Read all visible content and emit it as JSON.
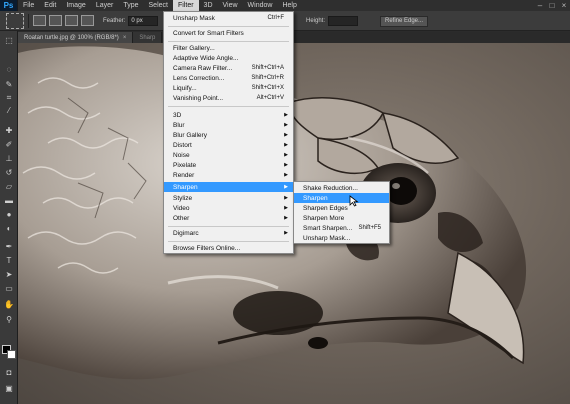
{
  "app": {
    "logo": "Ps",
    "menus": [
      "File",
      "Edit",
      "Image",
      "Layer",
      "Type",
      "Select",
      "Filter",
      "3D",
      "View",
      "Window",
      "Help"
    ],
    "active_menu": "Filter"
  },
  "options_bar": {
    "feather_label": "Feather:",
    "feather_value": "0 px",
    "height_label": "Height:",
    "refine_edge": "Refine Edge..."
  },
  "tabs": [
    {
      "label": "Roatan turtle.jpg @ 100% (RGB/8*)",
      "close": "×"
    },
    {
      "label": "Sharp"
    }
  ],
  "tools": {
    "icons": [
      "marquee-icon",
      "lasso-icon",
      "quick-select-icon",
      "crop-icon",
      "eyedropper-icon",
      "healing-brush-icon",
      "brush-icon",
      "clone-stamp-icon",
      "history-brush-icon",
      "eraser-icon",
      "gradient-icon",
      "blur-icon",
      "dodge-icon",
      "pen-icon",
      "type-icon",
      "path-select-icon",
      "shape-icon",
      "hand-icon",
      "zoom-icon"
    ]
  },
  "filter_menu": {
    "items": [
      {
        "label": "Unsharp Mask",
        "shortcut": "Ctrl+F"
      },
      {
        "label": "Convert for Smart Filters"
      },
      {
        "label": "Filter Gallery..."
      },
      {
        "label": "Adaptive Wide Angle...",
        "shortcut": ""
      },
      {
        "label": "Camera Raw Filter...",
        "shortcut": "Shift+Ctrl+A"
      },
      {
        "label": "Lens Correction...",
        "shortcut": "Shift+Ctrl+R"
      },
      {
        "label": "Liquify...",
        "shortcut": "Shift+Ctrl+X"
      },
      {
        "label": "Vanishing Point...",
        "shortcut": "Alt+Ctrl+V"
      },
      {
        "label": "3D",
        "submenu": true
      },
      {
        "label": "Blur",
        "submenu": true
      },
      {
        "label": "Blur Gallery",
        "submenu": true
      },
      {
        "label": "Distort",
        "submenu": true
      },
      {
        "label": "Noise",
        "submenu": true
      },
      {
        "label": "Pixelate",
        "submenu": true
      },
      {
        "label": "Render",
        "submenu": true
      },
      {
        "label": "Sharpen",
        "submenu": true,
        "highlighted": true
      },
      {
        "label": "Stylize",
        "submenu": true
      },
      {
        "label": "Video",
        "submenu": true
      },
      {
        "label": "Other",
        "submenu": true
      },
      {
        "label": "Digimarc",
        "submenu": true
      },
      {
        "label": "Browse Filters Online..."
      }
    ],
    "submenu_arrow": "▶"
  },
  "sharpen_submenu": {
    "items": [
      {
        "label": "Shake Reduction..."
      },
      {
        "label": "Sharpen",
        "highlighted": true
      },
      {
        "label": "Sharpen Edges"
      },
      {
        "label": "Sharpen More"
      },
      {
        "label": "Smart Sharpen...",
        "shortcut": "Shift+F5"
      },
      {
        "label": "Unsharp Mask..."
      }
    ]
  },
  "colors": {
    "highlight": "#3399ff",
    "menu_bg": "#f0f0f0",
    "ui_dark": "#3a3a3a"
  }
}
